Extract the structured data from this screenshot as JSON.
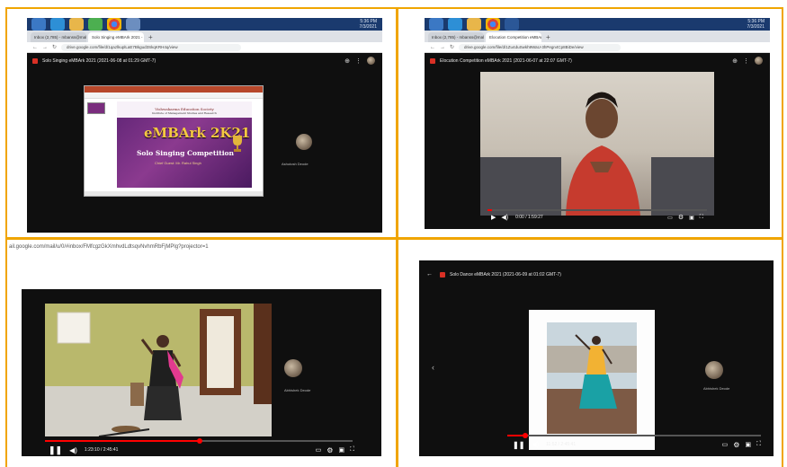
{
  "q1": {
    "taskbar_clock": [
      "5:36 PM",
      "7/3/2021"
    ],
    "tabs": [
      "Inbox (2,785) - mbanss@malhotr..",
      "Solo Singing eMBArk 2021 -"
    ],
    "url": "drive.google.com/file/d/1qazlkuplLaE7Bkgud3SkqKRH4q/view",
    "video_title": "Solo Singing eMBArk 2021 (2021-06-08 at 01:29 GMT-7)",
    "slide": {
      "header_line1": "Vishwakarma Education Society",
      "header_line2": "Institute of Management Studies and Research",
      "title": "eMBArk 2K21",
      "subtitle": "Solo Singing Competition",
      "chief": "Chief Guest: Mr. Rahul Singh"
    },
    "participant_name": "Ashutosh Deode"
  },
  "q2": {
    "taskbar_clock": [
      "5:36 PM",
      "7/3/2021"
    ],
    "tabs": [
      "Inbox (2,785) - mbanss@malhot..",
      "Elocution Competition eMBArk 2021 -"
    ],
    "url": "drive.google.com/file/d/1Zu4duSwkh9WaU-3hPegn4Cp8BiDe/view",
    "video_title": "Elocution Competition eMBArk 2021 (2021-06-07 at 22:07 GMT-7)",
    "time": "0:00 / 1:59:27",
    "progress": 0.02
  },
  "q3": {
    "url": "ail.google.com/mail/u/0/#inbox/FMfcgzGkXmhvdLdtsqvNvhmRbFjMPlg?projector=1",
    "participant_name": "Abhishek Deode",
    "time": "1:23:10 / 2:45:41",
    "progress": 0.502
  },
  "q4": {
    "video_title": "Solo Dance eMBArk 2021 (2021-06-09 at 01:02 GMT-7)",
    "participant_name": "Abhishek Deode",
    "time": "11:52 / 2:45:41",
    "progress": 0.072
  }
}
